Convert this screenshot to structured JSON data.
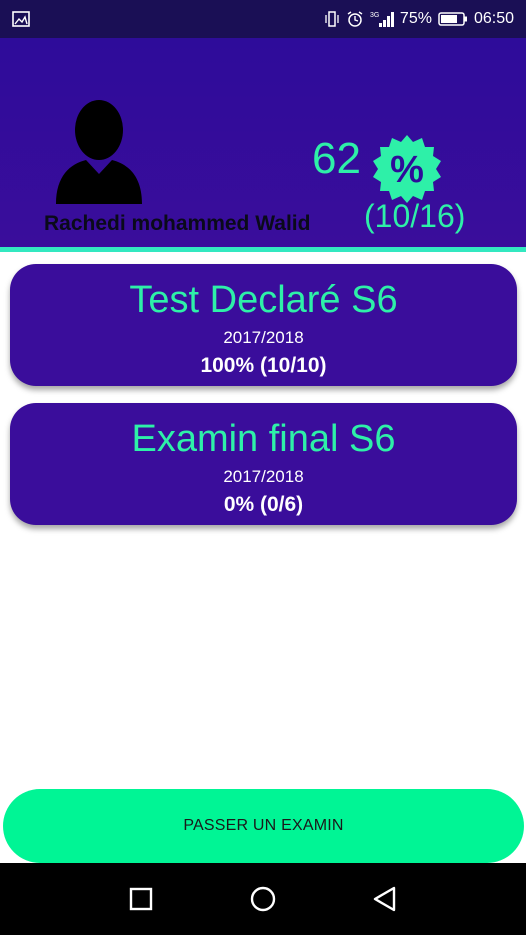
{
  "status_bar": {
    "network": "3G",
    "battery": "75%",
    "time": "06:50"
  },
  "profile": {
    "name": "Rachedi mohammed Walid",
    "score_percent": "62",
    "score_symbol": "%",
    "score_fraction": "(10/16)"
  },
  "cards": [
    {
      "title": "Test Declaré S6",
      "year": "2017/2018",
      "score": "100% (10/10)"
    },
    {
      "title": "Examin final S6",
      "year": "2017/2018",
      "score": "0% (0/6)"
    }
  ],
  "actions": {
    "exam_button": "PASSER UN EXAMIN"
  },
  "colors": {
    "header": "#2e0c9a",
    "accent": "#2ef0a8",
    "button": "#00f595",
    "card": "#3a0d9b"
  },
  "icons": [
    "image-icon",
    "vibrate-icon",
    "alarm-icon",
    "signal-icon",
    "battery-icon",
    "avatar-icon",
    "percent-badge-icon",
    "back-icon",
    "home-icon",
    "recents-icon"
  ]
}
